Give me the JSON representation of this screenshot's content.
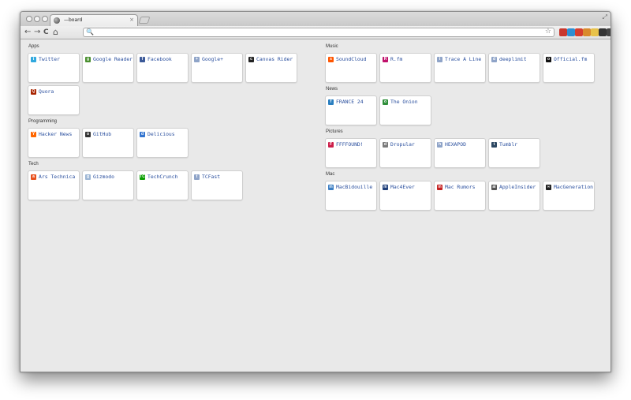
{
  "browser": {
    "tab_title": "—board",
    "close_glyph": "×",
    "resize_glyph": "⤢",
    "nav": {
      "back": "←",
      "forward": "→",
      "reload": "C",
      "home": "⌂"
    },
    "omnibox": {
      "value": "",
      "search_glyph": "🔍",
      "star_glyph": "☆"
    },
    "extensions": [
      {
        "name": "ext-shield-icon",
        "color": "#c8372d"
      },
      {
        "name": "ext-square-icon",
        "color": "#2e8fd2"
      },
      {
        "name": "ext-gmail-icon",
        "color": "#d63d2e"
      },
      {
        "name": "ext-tomato-icon",
        "color": "#d98a2c"
      },
      {
        "name": "ext-note-icon",
        "color": "#e8c24a"
      },
      {
        "name": "ext-pen-icon",
        "color": "#333333"
      },
      {
        "name": "wrench-icon",
        "color": "#444444"
      }
    ]
  },
  "sections_left": [
    {
      "title": "Apps",
      "items": [
        {
          "label": "Twitter",
          "icon": "twitter-icon",
          "color": "#2fa8de",
          "glyph": "t"
        },
        {
          "label": "Google Reader",
          "icon": "google-reader-icon",
          "color": "#4a8f2f",
          "glyph": "g"
        },
        {
          "label": "Facebook",
          "icon": "facebook-icon",
          "color": "#3b5998",
          "glyph": "f"
        },
        {
          "label": "Google+",
          "icon": "google-plus-icon",
          "color": "#8fa4c8",
          "glyph": "+"
        },
        {
          "label": "Canvas Rider",
          "icon": "canvas-rider-icon",
          "color": "#222222",
          "glyph": "c"
        },
        {
          "label": "Quora",
          "icon": "quora-icon",
          "color": "#a82400",
          "glyph": "Q"
        }
      ]
    },
    {
      "title": "Programming",
      "items": [
        {
          "label": "Hacker News",
          "icon": "hacker-news-icon",
          "color": "#ff6600",
          "glyph": "Y"
        },
        {
          "label": "GitHub",
          "icon": "github-icon",
          "color": "#333333",
          "glyph": "o"
        },
        {
          "label": "Delicious",
          "icon": "delicious-icon",
          "color": "#3274d0",
          "glyph": "d"
        }
      ]
    },
    {
      "title": "Tech",
      "items": [
        {
          "label": "Ars Technica",
          "icon": "ars-technica-icon",
          "color": "#e8501c",
          "glyph": "a"
        },
        {
          "label": "Gizmodo",
          "icon": "gizmodo-icon",
          "color": "#9db6d4",
          "glyph": "g"
        },
        {
          "label": "TechCrunch",
          "icon": "techcrunch-icon",
          "color": "#0a9e01",
          "glyph": "TC"
        },
        {
          "label": "TCFast",
          "icon": "tcfast-icon",
          "color": "#8fa4c8",
          "glyph": "t"
        }
      ]
    }
  ],
  "sections_right": [
    {
      "title": "Music",
      "items": [
        {
          "label": "SoundCloud",
          "icon": "soundcloud-icon",
          "color": "#ff5500",
          "glyph": "s"
        },
        {
          "label": "R.fm",
          "icon": "rfm-icon",
          "color": "#c0106b",
          "glyph": "R"
        },
        {
          "label": "Trace A Line",
          "icon": "trace-a-line-icon",
          "color": "#8fa4c8",
          "glyph": "t"
        },
        {
          "label": "deeplimit",
          "icon": "deeplimit-icon",
          "color": "#8fa4c8",
          "glyph": "d"
        },
        {
          "label": "Official.fm",
          "icon": "official-fm-icon",
          "color": "#111111",
          "glyph": "o"
        }
      ]
    },
    {
      "title": "News",
      "items": [
        {
          "label": "FRANCE 24",
          "icon": "france24-icon",
          "color": "#2a7fc0",
          "glyph": "f"
        },
        {
          "label": "The Onion",
          "icon": "the-onion-icon",
          "color": "#2f8f3a",
          "glyph": "o"
        }
      ]
    },
    {
      "title": "Pictures",
      "items": [
        {
          "label": "FFFFOUND!",
          "icon": "ffffound-icon",
          "color": "#cc1f4a",
          "glyph": "F"
        },
        {
          "label": "Dropular",
          "icon": "dropular-icon",
          "color": "#7a7a7a",
          "glyph": "d"
        },
        {
          "label": "HEXAPOD",
          "icon": "hexapod-icon",
          "color": "#8fa4c8",
          "glyph": "h"
        },
        {
          "label": "Tumblr",
          "icon": "tumblr-icon",
          "color": "#2c4762",
          "glyph": "t"
        }
      ]
    },
    {
      "title": "Mac",
      "items": [
        {
          "label": "MacBidouille",
          "icon": "macbidouille-icon",
          "color": "#3d7fc4",
          "glyph": "m"
        },
        {
          "label": "Mac4Ever",
          "icon": "mac4ever-icon",
          "color": "#1f3f7a",
          "glyph": "m"
        },
        {
          "label": "Mac Rumors",
          "icon": "mac-rumors-icon",
          "color": "#c41f1f",
          "glyph": "m"
        },
        {
          "label": "AppleInsider",
          "icon": "appleinsider-icon",
          "color": "#555555",
          "glyph": "ai"
        },
        {
          "label": "MacGeneration",
          "icon": "macgeneration-icon",
          "color": "#222222",
          "glyph": "∞"
        }
      ]
    }
  ]
}
